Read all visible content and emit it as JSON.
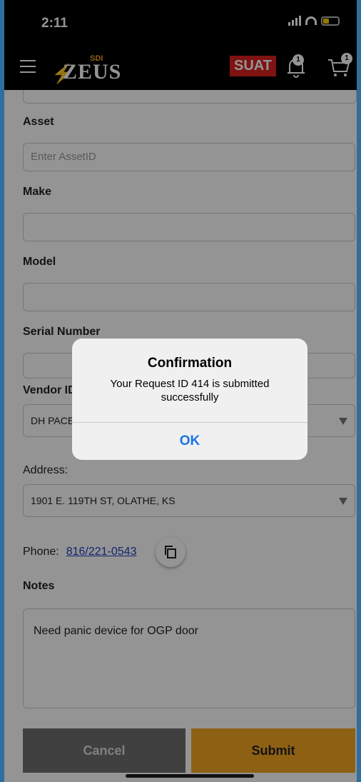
{
  "statusbar": {
    "time": "2:11"
  },
  "header": {
    "logo_sdi": "SDI",
    "logo_zeus": "ZEUS",
    "env_badge": "SUAT",
    "notification_count": "1",
    "cart_count": "1"
  },
  "form": {
    "asset_label": "Asset",
    "asset_placeholder": "Enter AssetID",
    "make_label": "Make",
    "model_label": "Model",
    "serial_label": "Serial Number",
    "vendor_label": "Vendor ID",
    "vendor_value": "DH PACE",
    "address_label": "Address:",
    "address_value": "1901 E. 119TH ST, OLATHE, KS",
    "phone_label": "Phone:",
    "phone_value": "816/221-0543",
    "notes_label": "Notes",
    "notes_value": "Need panic device for OGP door",
    "cancel_label": "Cancel",
    "submit_label": "Submit"
  },
  "dialog": {
    "title": "Confirmation",
    "message": "Your Request ID 414 is submitted successfully",
    "ok_label": "OK"
  },
  "colors": {
    "accent": "#f5a623",
    "badge_red": "#d9211f",
    "link_blue": "#1a73e8"
  }
}
